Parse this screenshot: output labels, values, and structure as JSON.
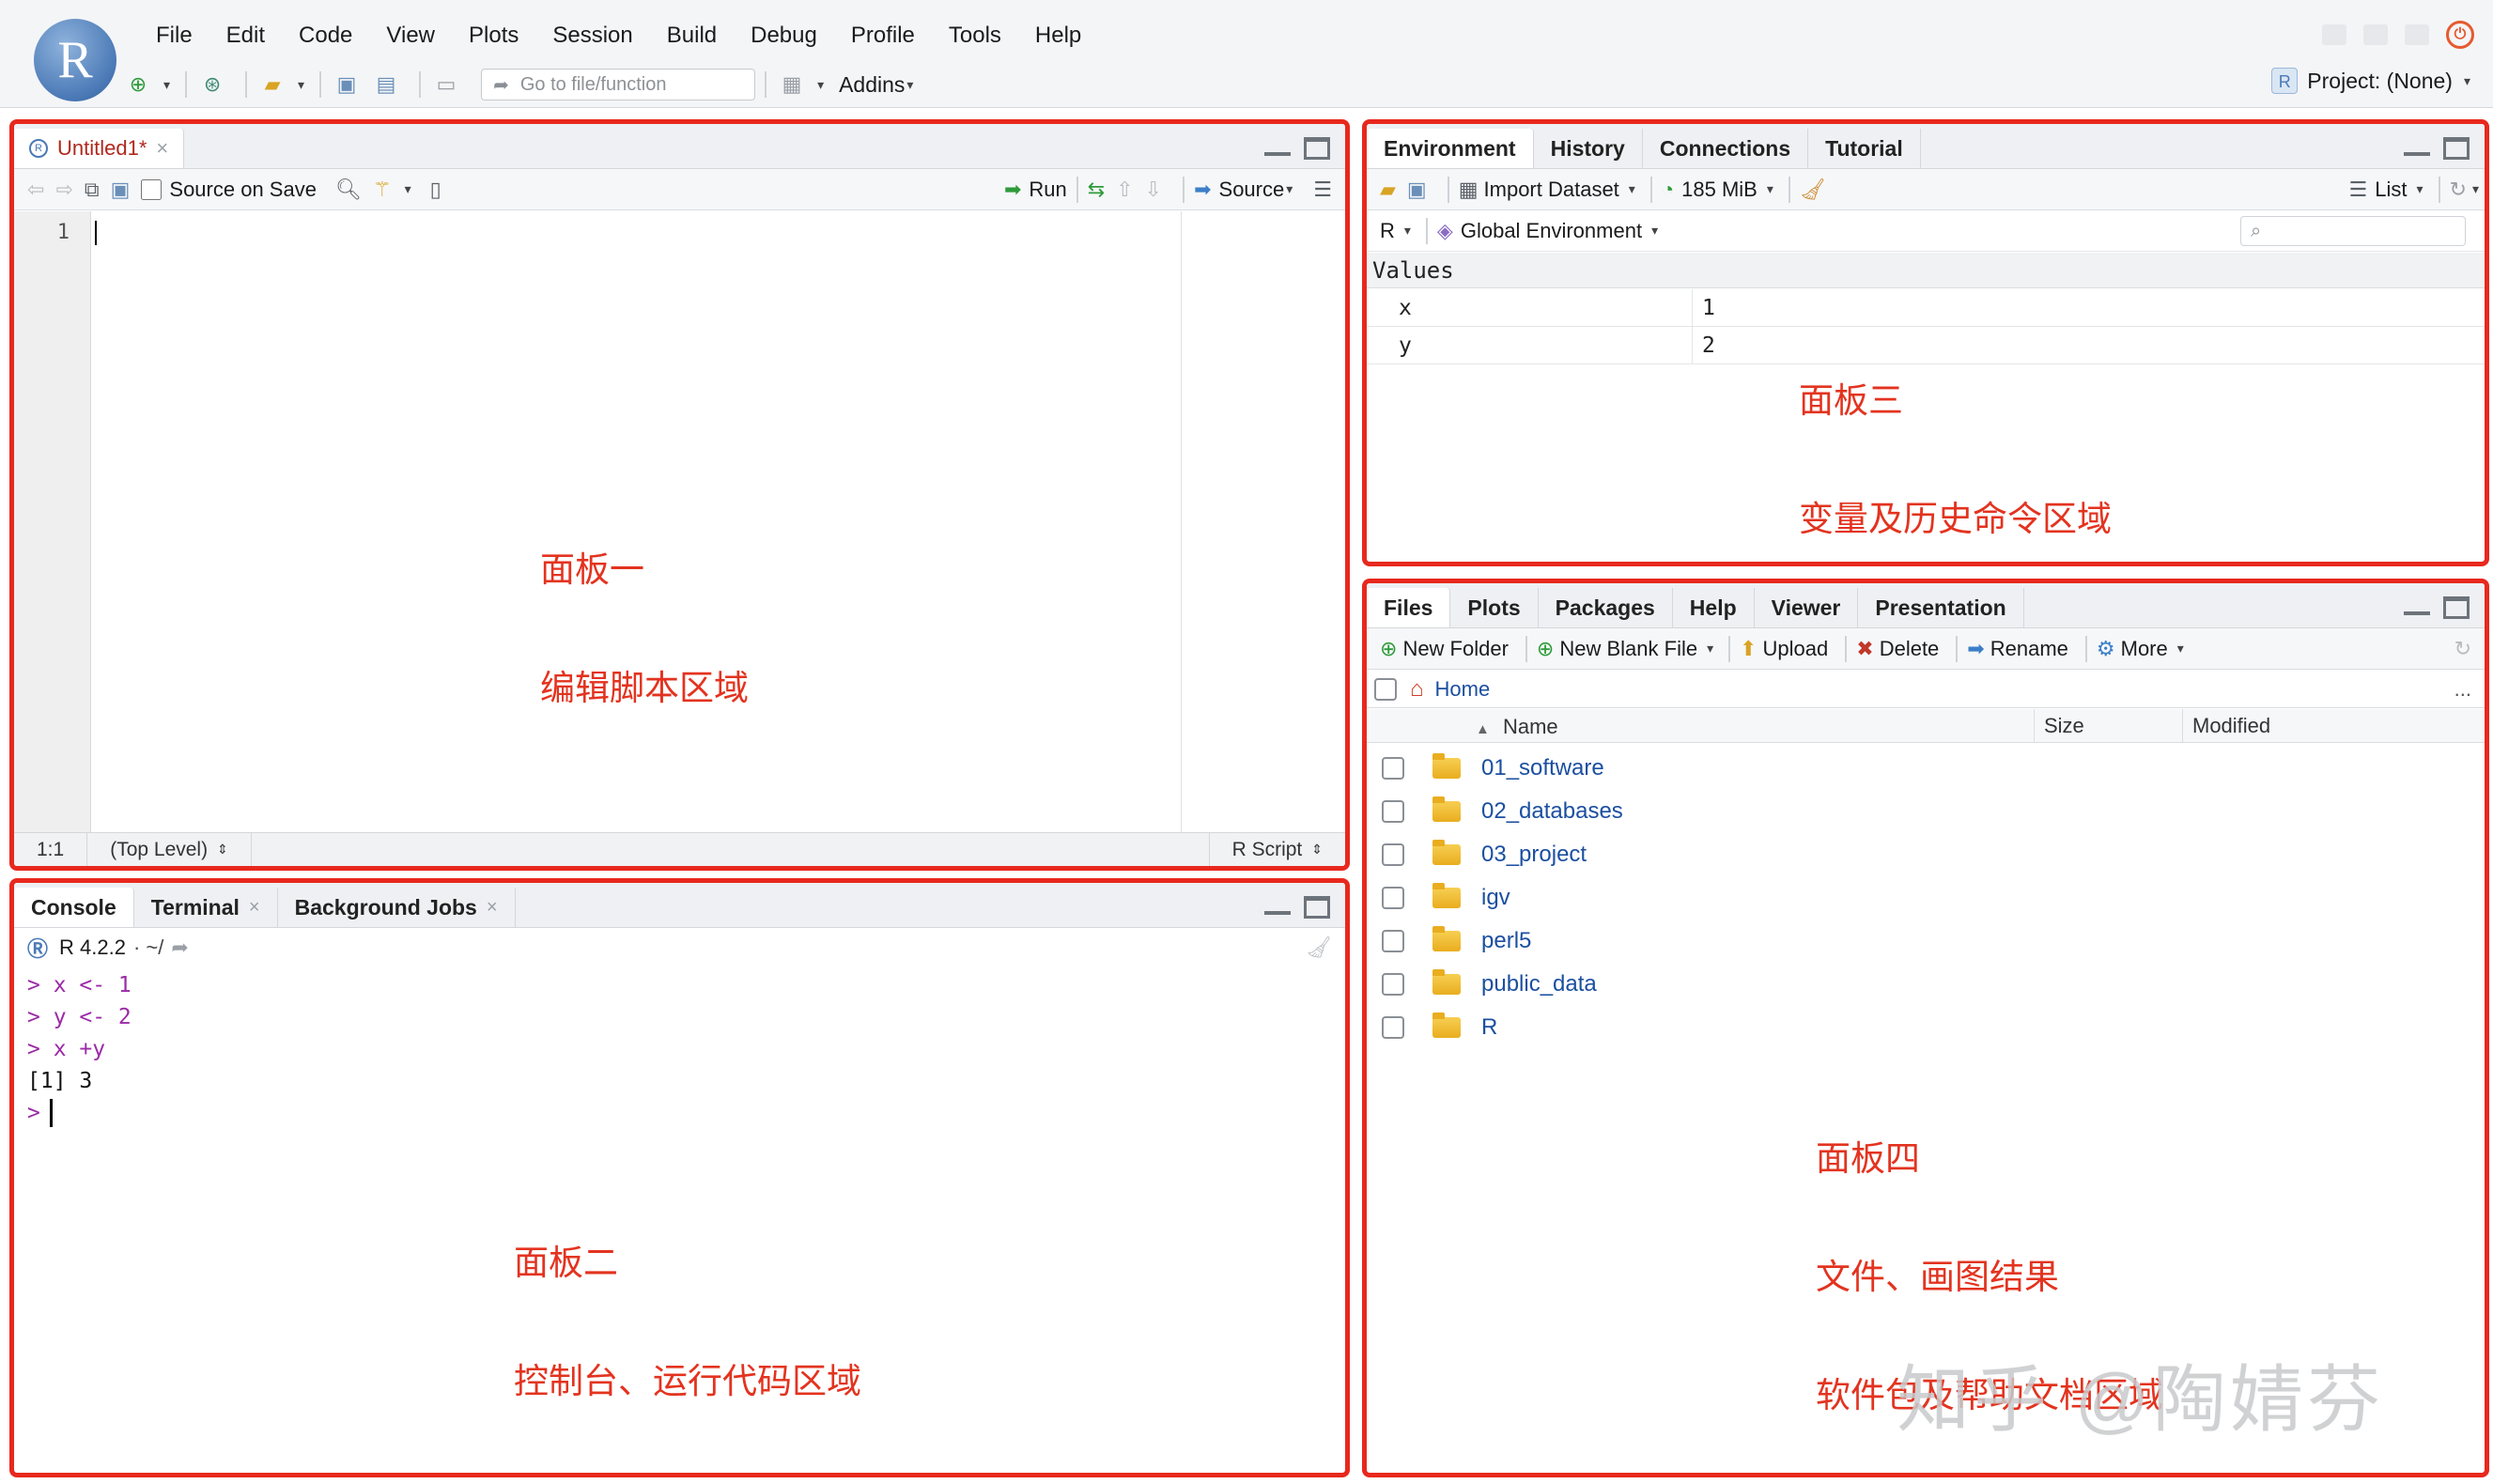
{
  "app": {
    "logo_letter": "R",
    "menus": [
      "File",
      "Edit",
      "Code",
      "View",
      "Plots",
      "Session",
      "Build",
      "Debug",
      "Profile",
      "Tools",
      "Help"
    ],
    "goto_placeholder": "Go to file/function",
    "addins_label": "Addins",
    "project_label": "Project: (None)"
  },
  "editor": {
    "tab_title": "Untitled1*",
    "source_on_save": "Source on Save",
    "run_label": "Run",
    "source_label": "Source",
    "line_numbers": [
      "1"
    ],
    "status_position": "1:1",
    "status_scope": "(Top Level)",
    "status_type": "R Script",
    "annotation_line1": "面板一",
    "annotation_line2": "编辑脚本区域"
  },
  "console": {
    "tabs": [
      {
        "label": "Console"
      },
      {
        "label": "Terminal"
      },
      {
        "label": "Background Jobs"
      }
    ],
    "r_version": "R 4.2.2",
    "workdir": "· ~/",
    "lines": [
      {
        "type": "cmd",
        "text": "> x <- 1"
      },
      {
        "type": "cmd",
        "text": "> y <- 2"
      },
      {
        "type": "cmd",
        "text": "> x +y"
      },
      {
        "type": "res",
        "text": "[1] 3"
      }
    ],
    "prompt": ">",
    "annotation_line1": "面板二",
    "annotation_line2": "控制台、运行代码区域"
  },
  "environment": {
    "tabs": [
      "Environment",
      "History",
      "Connections",
      "Tutorial"
    ],
    "import_dataset": "Import Dataset",
    "memory": "185 MiB",
    "view_mode": "List",
    "language": "R",
    "scope": "Global Environment",
    "values_header": "Values",
    "variables": [
      {
        "name": "x",
        "value": "1"
      },
      {
        "name": "y",
        "value": "2"
      }
    ],
    "annotation_line1": "面板三",
    "annotation_line2": "变量及历史命令区域"
  },
  "files": {
    "tabs": [
      "Files",
      "Plots",
      "Packages",
      "Help",
      "Viewer",
      "Presentation"
    ],
    "new_folder": "New Folder",
    "new_blank_file": "New Blank File",
    "upload": "Upload",
    "delete": "Delete",
    "rename": "Rename",
    "more": "More",
    "home": "Home",
    "ellipsis": "...",
    "col_name": "Name",
    "col_size": "Size",
    "col_modified": "Modified",
    "items": [
      "01_software",
      "02_databases",
      "03_project",
      "igv",
      "perl5",
      "public_data",
      "R"
    ],
    "annotation_line1": "面板四",
    "annotation_line2": "文件、画图结果",
    "annotation_line3": "软件包及帮助文档区域"
  },
  "watermark": "知乎 @陶婧芬",
  "colors": {
    "annotation_red": "#e3331f",
    "panel_border": "#e8281d",
    "console_cmd": "#9c2aa7",
    "link_blue": "#1b4fa0"
  }
}
